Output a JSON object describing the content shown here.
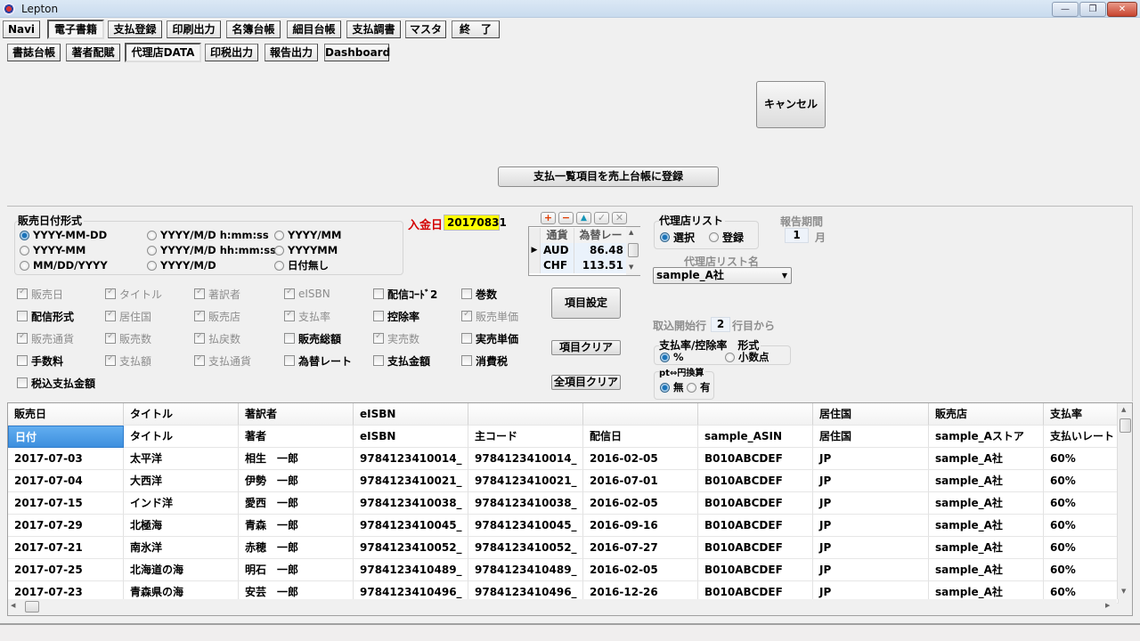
{
  "window": {
    "title": "Lepton",
    "controls": {
      "minimize": "—",
      "restore": "❐",
      "close": "✕"
    }
  },
  "main_tabs": [
    {
      "label": "Navi"
    },
    {
      "label": "電子書籍"
    },
    {
      "label": "支払登録"
    },
    {
      "label": "印刷出力"
    },
    {
      "label": "名簿台帳"
    },
    {
      "label": "細目台帳"
    },
    {
      "label": "支払調書"
    },
    {
      "label": "マスタ"
    },
    {
      "label": "終　了"
    }
  ],
  "main_tabs_selected": "電子書籍",
  "sub_tabs": [
    {
      "label": "書誌台帳"
    },
    {
      "label": "著者配賦"
    },
    {
      "label": "代理店DATA"
    },
    {
      "label": "印税出力"
    },
    {
      "label": "報告出力"
    },
    {
      "label": "Dashboard"
    }
  ],
  "sub_tabs_selected": "代理店DATA",
  "actions": {
    "cancel": "キャンセル",
    "register": "支払一覧項目を売上台帳に登録",
    "item_settings": "項目設定",
    "item_clear": "項目クリア",
    "all_item_clear": "全項目クリア"
  },
  "date_format": {
    "label": "販売日付形式",
    "options": [
      {
        "label": "YYYY-MM-DD",
        "checked": true
      },
      {
        "label": "YYYY/M/D h:mm:ss",
        "checked": false
      },
      {
        "label": "YYYY/MM",
        "checked": false
      },
      {
        "label": "YYYY-MM",
        "checked": false
      },
      {
        "label": "YYYY/M/D hh:mm:ss",
        "checked": false
      },
      {
        "label": "YYYYMM",
        "checked": false
      },
      {
        "label": "MM/DD/YYYY",
        "checked": false
      },
      {
        "label": "YYYY/M/D",
        "checked": false
      },
      {
        "label": "日付無し",
        "checked": false
      }
    ]
  },
  "deposit_date": {
    "label": "入金日",
    "value": "20170831"
  },
  "currency": {
    "toolbar": {
      "add": "+",
      "remove": "−",
      "up": "▲",
      "confirm": "✓",
      "cancel": "✕"
    },
    "headers": [
      "通貨",
      "為替レート"
    ],
    "rows": [
      {
        "code": "AUD",
        "rate": "86.48",
        "current": true
      },
      {
        "code": "CHF",
        "rate": "113.51",
        "current": false
      }
    ]
  },
  "agency_list": {
    "label": "代理店リスト",
    "options": [
      {
        "label": "選択",
        "checked": true
      },
      {
        "label": "登録",
        "checked": false
      }
    ],
    "name_label": "代理店リスト名",
    "selected_name": "sample_A社"
  },
  "report_period": {
    "label": "報告期間",
    "value": "1",
    "unit": "月"
  },
  "import_start": {
    "label": "取込開始行",
    "value": "2",
    "suffix": "行目から"
  },
  "rate_format": {
    "label": "支払率/控除率　形式",
    "options": [
      {
        "label": "%",
        "checked": true
      },
      {
        "label": "小数点",
        "checked": false
      }
    ]
  },
  "pt_conversion": {
    "label": "pt⇔円換算",
    "options": [
      {
        "label": "無",
        "checked": true
      },
      {
        "label": "有",
        "checked": false
      }
    ]
  },
  "fields": [
    {
      "label": "販売日",
      "checked": true,
      "disabled": true
    },
    {
      "label": "タイトル",
      "checked": true,
      "disabled": true
    },
    {
      "label": "著訳者",
      "checked": true,
      "disabled": true
    },
    {
      "label": "eISBN",
      "checked": true,
      "disabled": true
    },
    {
      "label": "配信ｺｰﾄﾞ2",
      "checked": false,
      "disabled": false
    },
    {
      "label": "巻数",
      "checked": false,
      "disabled": false
    },
    {
      "label": "配信形式",
      "checked": false,
      "disabled": false
    },
    {
      "label": "居住国",
      "checked": true,
      "disabled": true
    },
    {
      "label": "販売店",
      "checked": true,
      "disabled": true
    },
    {
      "label": "支払率",
      "checked": true,
      "disabled": true
    },
    {
      "label": "控除率",
      "checked": false,
      "disabled": false
    },
    {
      "label": "販売単価",
      "checked": true,
      "disabled": true
    },
    {
      "label": "販売通貨",
      "checked": true,
      "disabled": true
    },
    {
      "label": "販売数",
      "checked": true,
      "disabled": true
    },
    {
      "label": "払戻数",
      "checked": true,
      "disabled": true
    },
    {
      "label": "販売総額",
      "checked": false,
      "disabled": false
    },
    {
      "label": "実売数",
      "checked": true,
      "disabled": true
    },
    {
      "label": "実売単価",
      "checked": false,
      "disabled": false
    },
    {
      "label": "手数料",
      "checked": false,
      "disabled": false
    },
    {
      "label": "支払額",
      "checked": true,
      "disabled": true
    },
    {
      "label": "支払通貨",
      "checked": true,
      "disabled": true
    },
    {
      "label": "為替レート",
      "checked": false,
      "disabled": false
    },
    {
      "label": "支払金額",
      "checked": false,
      "disabled": false
    },
    {
      "label": "消費税",
      "checked": false,
      "disabled": false
    },
    {
      "label": "税込支払金額",
      "checked": false,
      "disabled": false
    }
  ],
  "table": {
    "headers": [
      "販売日",
      "タイトル",
      "著訳者",
      "eISBN",
      "",
      "",
      "",
      "居住国",
      "販売店",
      "支払率"
    ],
    "mapping_row": [
      "日付",
      "タイトル",
      "著者",
      "eISBN",
      "主コード",
      "配信日",
      "sample_ASIN",
      "居住国",
      "sample_Aストア",
      "支払いレート"
    ],
    "rows": [
      [
        "2017-07-03",
        "太平洋",
        "相生　一郎",
        "9784123410014_",
        "9784123410014_",
        "2016-02-05",
        "B010ABCDEF",
        "JP",
        "sample_A社",
        "60%"
      ],
      [
        "2017-07-04",
        "大西洋",
        "伊勢　一郎",
        "9784123410021_",
        "9784123410021_",
        "2016-07-01",
        "B010ABCDEF",
        "JP",
        "sample_A社",
        "60%"
      ],
      [
        "2017-07-15",
        "インド洋",
        "愛西　一郎",
        "9784123410038_",
        "9784123410038_",
        "2016-02-05",
        "B010ABCDEF",
        "JP",
        "sample_A社",
        "60%"
      ],
      [
        "2017-07-29",
        "北極海",
        "青森　一郎",
        "9784123410045_",
        "9784123410045_",
        "2016-09-16",
        "B010ABCDEF",
        "JP",
        "sample_A社",
        "60%"
      ],
      [
        "2017-07-21",
        "南氷洋",
        "赤穂　一郎",
        "9784123410052_",
        "9784123410052_",
        "2016-07-27",
        "B010ABCDEF",
        "JP",
        "sample_A社",
        "60%"
      ],
      [
        "2017-07-25",
        "北海道の海",
        "明石　一郎",
        "9784123410489_",
        "9784123410489_",
        "2016-02-05",
        "B010ABCDEF",
        "JP",
        "sample_A社",
        "60%"
      ],
      [
        "2017-07-23",
        "青森県の海",
        "安芸　一郎",
        "9784123410496_",
        "9784123410496_",
        "2016-12-26",
        "B010ABCDEF",
        "JP",
        "sample_A社",
        "60%"
      ]
    ]
  },
  "colors": {
    "deposit_label": "#d40000",
    "deposit_bg": "#ffff00",
    "selected_cell": "#3d8fde"
  }
}
